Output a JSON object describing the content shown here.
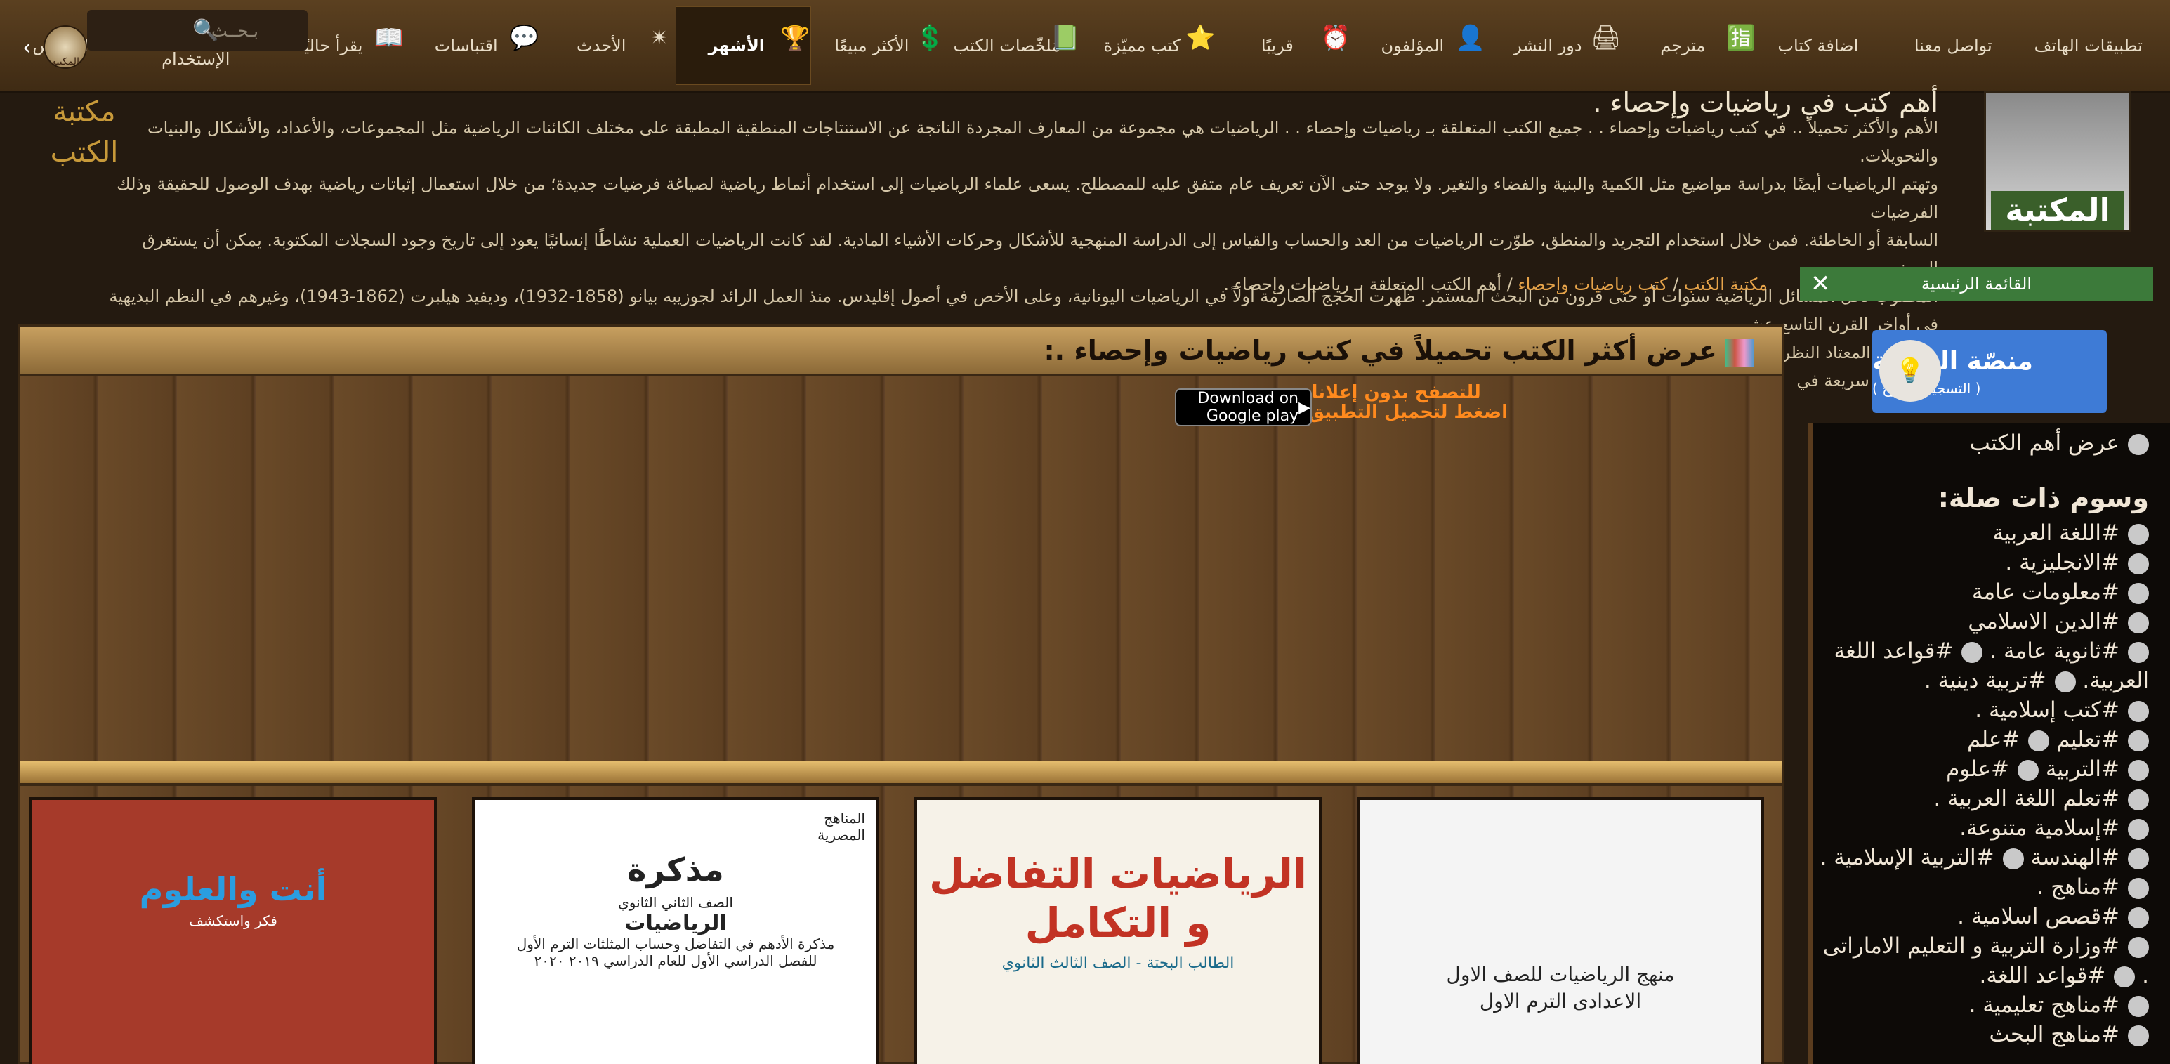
{
  "nav": {
    "items": [
      {
        "label": "تطبيقات الهاتف"
      },
      {
        "label": "تواصل معنا"
      },
      {
        "label": "اضافة كتاب"
      },
      {
        "label": "مترجم"
      },
      {
        "label": "دور النشر"
      },
      {
        "label": "المؤلفون"
      },
      {
        "label": "قريبًا"
      },
      {
        "label": "كتب مميّزة"
      },
      {
        "label": "مُلخّصات الكتب"
      },
      {
        "label": "الأكثر مبيعًا"
      },
      {
        "label": "الأشهر"
      },
      {
        "label": "الأحدث"
      },
      {
        "label": "اقتباسات"
      },
      {
        "label": "يقرأ حاليًا"
      },
      {
        "label": "✓ إتفاقية الإستخدام"
      },
      {
        "label": "الفهرس"
      }
    ],
    "search_placeholder": "بـحــث"
  },
  "logo": {
    "small": "المكتبة",
    "big": "المكتبة",
    "calligraphy": "مكتبة الكتب"
  },
  "description": {
    "title": "أهم كتب في رياضيات وإحصاء .",
    "lines": [
      "الأهم والأكثر تحميلاً .. في كتب رياضيات وإحصاء . . جميع الكتب المتعلقة بـ رياضيات وإحصاء . . الرياضيات هي مجموعة من المعارف المجردة الناتجة عن الاستنتاجات المنطقية المطبقة على مختلف الكائنات الرياضية مثل المجموعات، والأعداد، والأشكال والبنيات والتحويلات.",
      "وتهتم الرياضيات أيضًا بدراسة مواضيع مثل الكمية والبنية والفضاء والتغير. ولا يوجد حتى الآن تعريف عام متفق عليه للمصطلح. يسعى علماء الرياضيات إلى استخدام أنماط رياضية لصياغة فرضيات جديدة؛ من خلال استعمال إثباتات رياضية بهدف الوصول للحقيقة وذلك الفرضيات",
      "السابقة أو الخاطئة. فمن خلال استخدام التجريد والمنطق، طوّرت الرياضيات من العد والحساب والقياس إلى الدراسة المنهجية للأشكال وحركات الأشياء المادية. لقد كانت الرياضيات العملية نشاطًا إنسانيًا يعود إلى تاريخ وجود السجلات المكتوبة. يمكن أن يستغرق البحث",
      "المطلوب لحل المسائل الرياضية سنوات أو حتى قرون من البحث المستمر. ظهرت الحجج الصارمة أولاً في الرياضيات اليونانية، وعلى الأخص في أصول إقليدس. منذ العمل الرائد لجوزيبه بيانو (1858-1932)، وديفيد هيلبرت (1862-1943)، وغيرهم في النظم البديهية في أواخر القرن التاسع عشر،",
      "أصبح من المعتاد النظر إلى الأبحاث الرياضية كإثبات للحقيقة عن طريق الاستنتاج الدقيق للبديهيات والتعاريف المختارة بشكل مناسب. وتطورت الرياضيات بوتيرة بطيئة نسبيًا حتى عصر النهضة، عندما أدت الابتكارات الرياضية التي تتفاعل مع الاكتشافات العلمية الجديدة إلى زيادة سريعة في"
    ]
  },
  "breadcrumb": {
    "home": "مكتبة الكتب",
    "category": "كتب رياضيات وإحصاء",
    "current": "أهم الكتب المتعلقة بـ رياضيات وإحصاء ."
  },
  "main_menu": {
    "label": "القائمة الرئيسية",
    "close": "✕"
  },
  "platform": {
    "title": "منصّة المكتبة",
    "subtitle": "( التسجيل مفتوح )"
  },
  "sidebar": {
    "show_top": "عرض أهم الكتب",
    "tags_heading": "وسوم ذات صلة:",
    "tags": [
      "#اللغة العربية",
      "#الانجليزية .",
      "#معلومات عامة",
      "#الدين الاسلامي",
      "#ثانوية عامة .",
      "#قواعد اللغة العربية.",
      "#تربية دينية .",
      "#كتب إسلامية .",
      "#تعليم",
      "#علم",
      "#التربية",
      "#علوم",
      "#تعلم اللغة العربية .",
      "#إسلامية متنوعة.",
      "#الهندسة",
      "#التربية الإسلامية .",
      "#مناهج .",
      "#قصص اسلامية .",
      "#وزارة التربية و التعليم الاماراتى .",
      "#قواعد اللغة.",
      "#مناهج تعليمية .",
      "#مناهج البحث"
    ]
  },
  "panel": {
    "title": "عرض أكثر الكتب تحميلاً في كتب رياضيات وإحصاء .:",
    "ads_line1": "للتصفح بدون إعلانات",
    "ads_line2": "اضغط لتحميل التطبيق الآن",
    "gplay": "Download on Google play"
  },
  "books": [
    {
      "title": "منهج الرياضيات للصف الاول الاعدادى الترم الاول"
    },
    {
      "title": "الرياضيات التفاضل و التكامل",
      "sub": "الطالب البحتة - الصف الثالث الثانوي"
    },
    {
      "title": "مذكرة",
      "l2": "الصف الثاني الثانوي",
      "l3": "الرياضيات",
      "l4": "مذكرة الأدهم في التفاضل وحساب المثلثات الترم الأول",
      "l5": "للفصل الدراسي الأول للعام الدراسي ٢٠١٩ ٢٠٢٠",
      "tag": "المناهج المصرية"
    },
    {
      "title": "أنت والعلوم",
      "sub": "فكر واستكشف"
    }
  ]
}
